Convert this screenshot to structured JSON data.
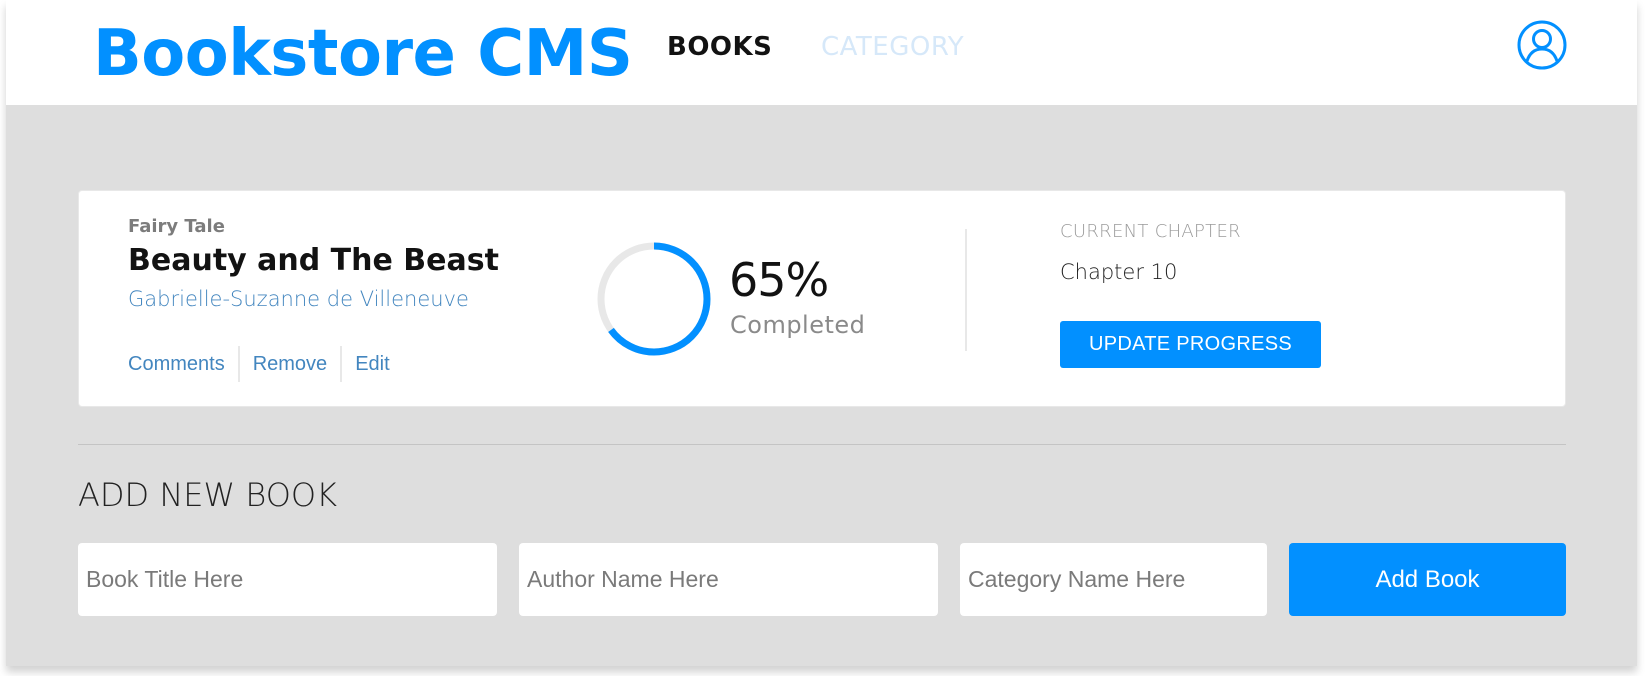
{
  "header": {
    "logo": "Bookstore CMS",
    "nav": {
      "books": "BOOKS",
      "category": "CATEGORY"
    },
    "avatar_icon": "user-circle-icon",
    "accent_color": "#0290ff"
  },
  "book": {
    "genre": "Fairy Tale",
    "title": "Beauty and The Beast",
    "author": "Gabrielle-Suzanne de Villeneuve",
    "actions": {
      "comments": "Comments",
      "remove": "Remove",
      "edit": "Edit"
    },
    "progress_percent": 65,
    "progress_text": "65%",
    "completed_label": "Completed",
    "current_chapter_label": "CURRENT CHAPTER",
    "current_chapter": "Chapter 10",
    "update_button": "UPDATE PROGRESS"
  },
  "add_form": {
    "heading": "ADD NEW BOOK",
    "title_placeholder": "Book Title Here",
    "author_placeholder": "Author Name Here",
    "category_placeholder": "Category Name Here",
    "submit_label": "Add Book"
  }
}
